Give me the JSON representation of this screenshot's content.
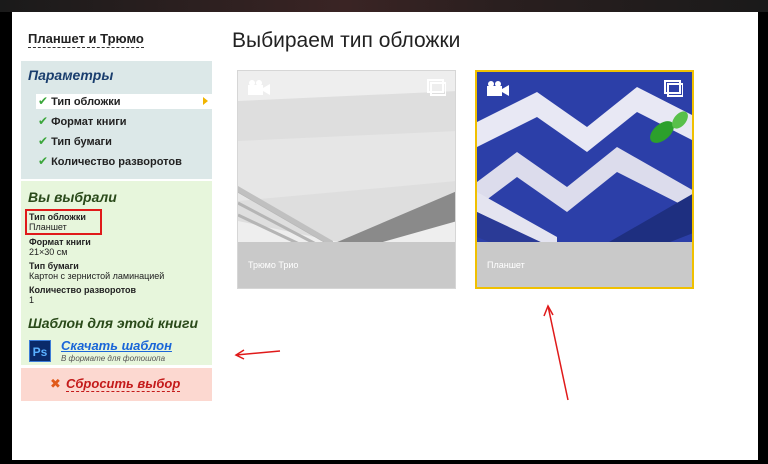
{
  "brand": "Планшет и Трюмо",
  "page_title": "Выбираем тип обложки",
  "params": {
    "title": "Параметры",
    "items": [
      {
        "label": "Тип обложки"
      },
      {
        "label": "Формат книги"
      },
      {
        "label": "Тип бумаги"
      },
      {
        "label": "Количество разворотов"
      }
    ]
  },
  "chosen": {
    "title": "Вы выбрали",
    "rows": [
      {
        "label": "Тип обложки",
        "value": "Планшет"
      },
      {
        "label": "Формат книги",
        "value": "21×30 см"
      },
      {
        "label": "Тип бумаги",
        "value": "Картон с зернистой ламинацией"
      },
      {
        "label": "Количество разворотов",
        "value": "1"
      }
    ],
    "template_title": "Шаблон для этой книги",
    "download_label": "Скачать шаблон",
    "download_sub": "В формате для фотошопа",
    "ps_text": "Ps"
  },
  "reset_label": "Сбросить выбор",
  "cards": [
    {
      "caption": "Трюмо Трио",
      "selected": false
    },
    {
      "caption": "Планшет",
      "selected": true
    }
  ],
  "colors": {
    "accent_border": "#f0c000",
    "annotation": "#e01a1a"
  }
}
